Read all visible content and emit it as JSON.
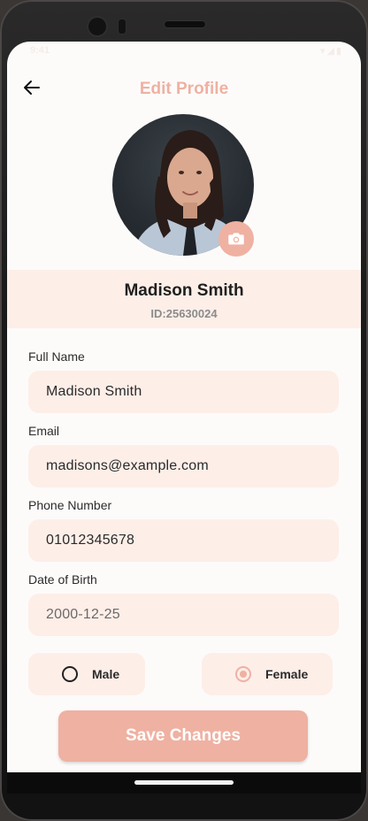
{
  "statusbar": {
    "time": "9:41",
    "icons": "▾◢▮"
  },
  "header": {
    "title": "Edit Profile"
  },
  "profile": {
    "name": "Madison Smith",
    "id": "ID:25630024"
  },
  "form": {
    "full_name": {
      "label": "Full Name",
      "value": "Madison Smith"
    },
    "email": {
      "label": "Email",
      "value": "madisons@example.com"
    },
    "phone": {
      "label": "Phone Number",
      "value": "01012345678"
    },
    "dob": {
      "label": "Date of Birth",
      "value": "2000-12-25"
    }
  },
  "gender": {
    "options": [
      {
        "label": "Male",
        "selected": false
      },
      {
        "label": "Female",
        "selected": true
      }
    ]
  },
  "actions": {
    "save_label": "Save Changes"
  },
  "colors": {
    "accent": "#efb1a2",
    "field_bg": "#fdeee8",
    "band_bg": "#fdeee8"
  }
}
